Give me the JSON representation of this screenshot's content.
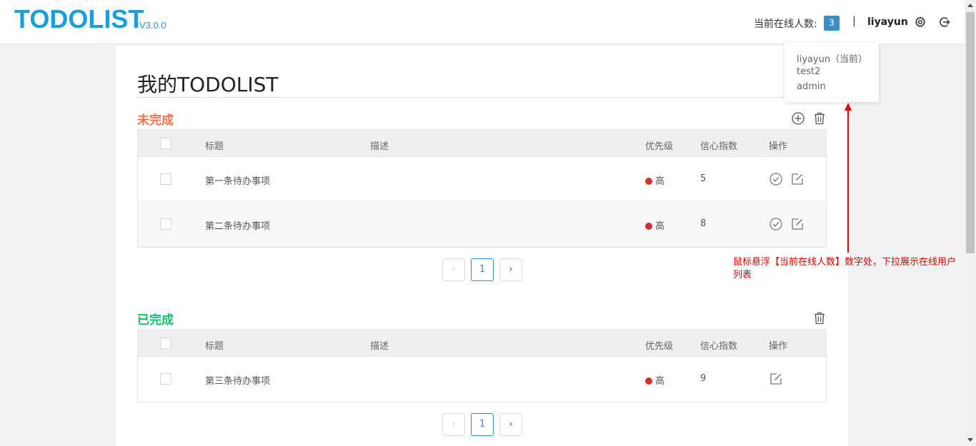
{
  "header": {
    "logo": "TODOLIST",
    "version": "V3.0.0",
    "online_label": "当前在线人数:",
    "online_count": "3",
    "separator": "|",
    "username": "liyayun",
    "icons": [
      "gear-icon",
      "logout-icon"
    ]
  },
  "online_users": [
    "liyayun（当前）",
    "test2",
    "admin"
  ],
  "page": {
    "title": "我的TODOLIST"
  },
  "columns": {
    "title": "标题",
    "desc": "描述",
    "priority": "优先级",
    "confidence": "信心指数",
    "action": "操作"
  },
  "pending": {
    "label": "未完成",
    "color": "#f5734b",
    "rows": [
      {
        "title": "第一条待办事项",
        "desc": "",
        "priority": "高",
        "confidence": "5"
      },
      {
        "title": "第二条待办事项",
        "desc": "",
        "priority": "高",
        "confidence": "8"
      }
    ],
    "page": "1"
  },
  "done": {
    "label": "已完成",
    "color": "#19be6b",
    "rows": [
      {
        "title": "第三条待办事项",
        "desc": "",
        "priority": "高",
        "confidence": "9"
      }
    ],
    "page": "1"
  },
  "annotation": "鼠标悬浮【当前在线人数】数字处，下拉展示在线用户列表",
  "colors": {
    "brand": "#1a9fd8",
    "priority_high": "#d3302c",
    "pager_active": "#2d8cf0",
    "annotation": "#dd0000"
  }
}
